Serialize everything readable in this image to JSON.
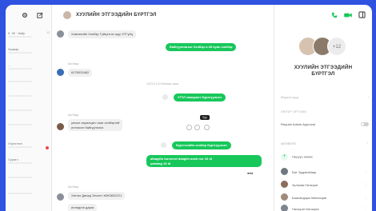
{
  "left": {
    "items": [
      {
        "name": "9. 35 · байр",
        "time": "13"
      },
      {
        "name": "Заавар",
        "time": ""
      },
      {
        "name": "...",
        "time": ""
      },
      {
        "name": "",
        "time": ""
      },
      {
        "name": "",
        "time": ""
      },
      {
        "name": "",
        "time": ""
      },
      {
        "name": "",
        "time": ""
      },
      {
        "name": "Хэрэглэгч",
        "time": ""
      },
      {
        "name": "Сурагч",
        "time": ""
      },
      {
        "name": "",
        "time": ""
      },
      {
        "name": "",
        "time": ""
      }
    ]
  },
  "chat": {
    "title": "ХУУЛИЙН ЭТГЭЭДИЙН БҮРТГЭЛ",
    "msg1": "Хэвлэлийн Хэлбэр Гүйцэтгэх шуу ХТГүйц",
    "out1": "Байгууллагын Хэлбэр и 48 хувь хэлбэр",
    "sender2": "Батбаяр",
    "msg2": "6278033462",
    "date": "2023.01.24 Мягмар гараг",
    "out2": "УТҮЛ хавсралт бүртгүүлсэн",
    "sender3": "Батбаяр",
    "msg3a": "улсын харилцагч хаяг хэлбэртэй",
    "msg3b": "илгээсэн байгууллага",
    "tooltip": "Хуу",
    "sender4": "",
    "out3": "Бүртгэлийн хэлбэр бүртгүүлсэн",
    "out4a": "albagiiin bursevel daagiin avah nor 16 dl",
    "out4b": "yaladag 16 dl",
    "sender5": "Батбаяр",
    "msg5": "Хатгах Дахад Элсэлт ЖЖ3832221",
    "msg6": "иллэдгэн дарга"
  },
  "right": {
    "extra_members": "+12",
    "group_name_1": "ХУУЛИЙН ЭТГЭЭДИЙН",
    "group_name_2": "БҮРТГЭЛ",
    "sec_media": "Мэдээллүүд",
    "sec_options": "GROUP OPTIONS",
    "approval": "Require Admin Approval",
    "sec_members": "MEMBERS",
    "add_member": "Гишүүн нэмэх",
    "members": [
      {
        "name": "Бат Эрдэнэбаяр"
      },
      {
        "name": "Зулзаяа Ганзориг"
      },
      {
        "name": "Баасандорж Мөнхзориг"
      },
      {
        "name": "Ганзориг Батзориг"
      }
    ]
  },
  "colors": {
    "accent_green": "#17c75a",
    "frame_bg": "#2f52e0"
  }
}
